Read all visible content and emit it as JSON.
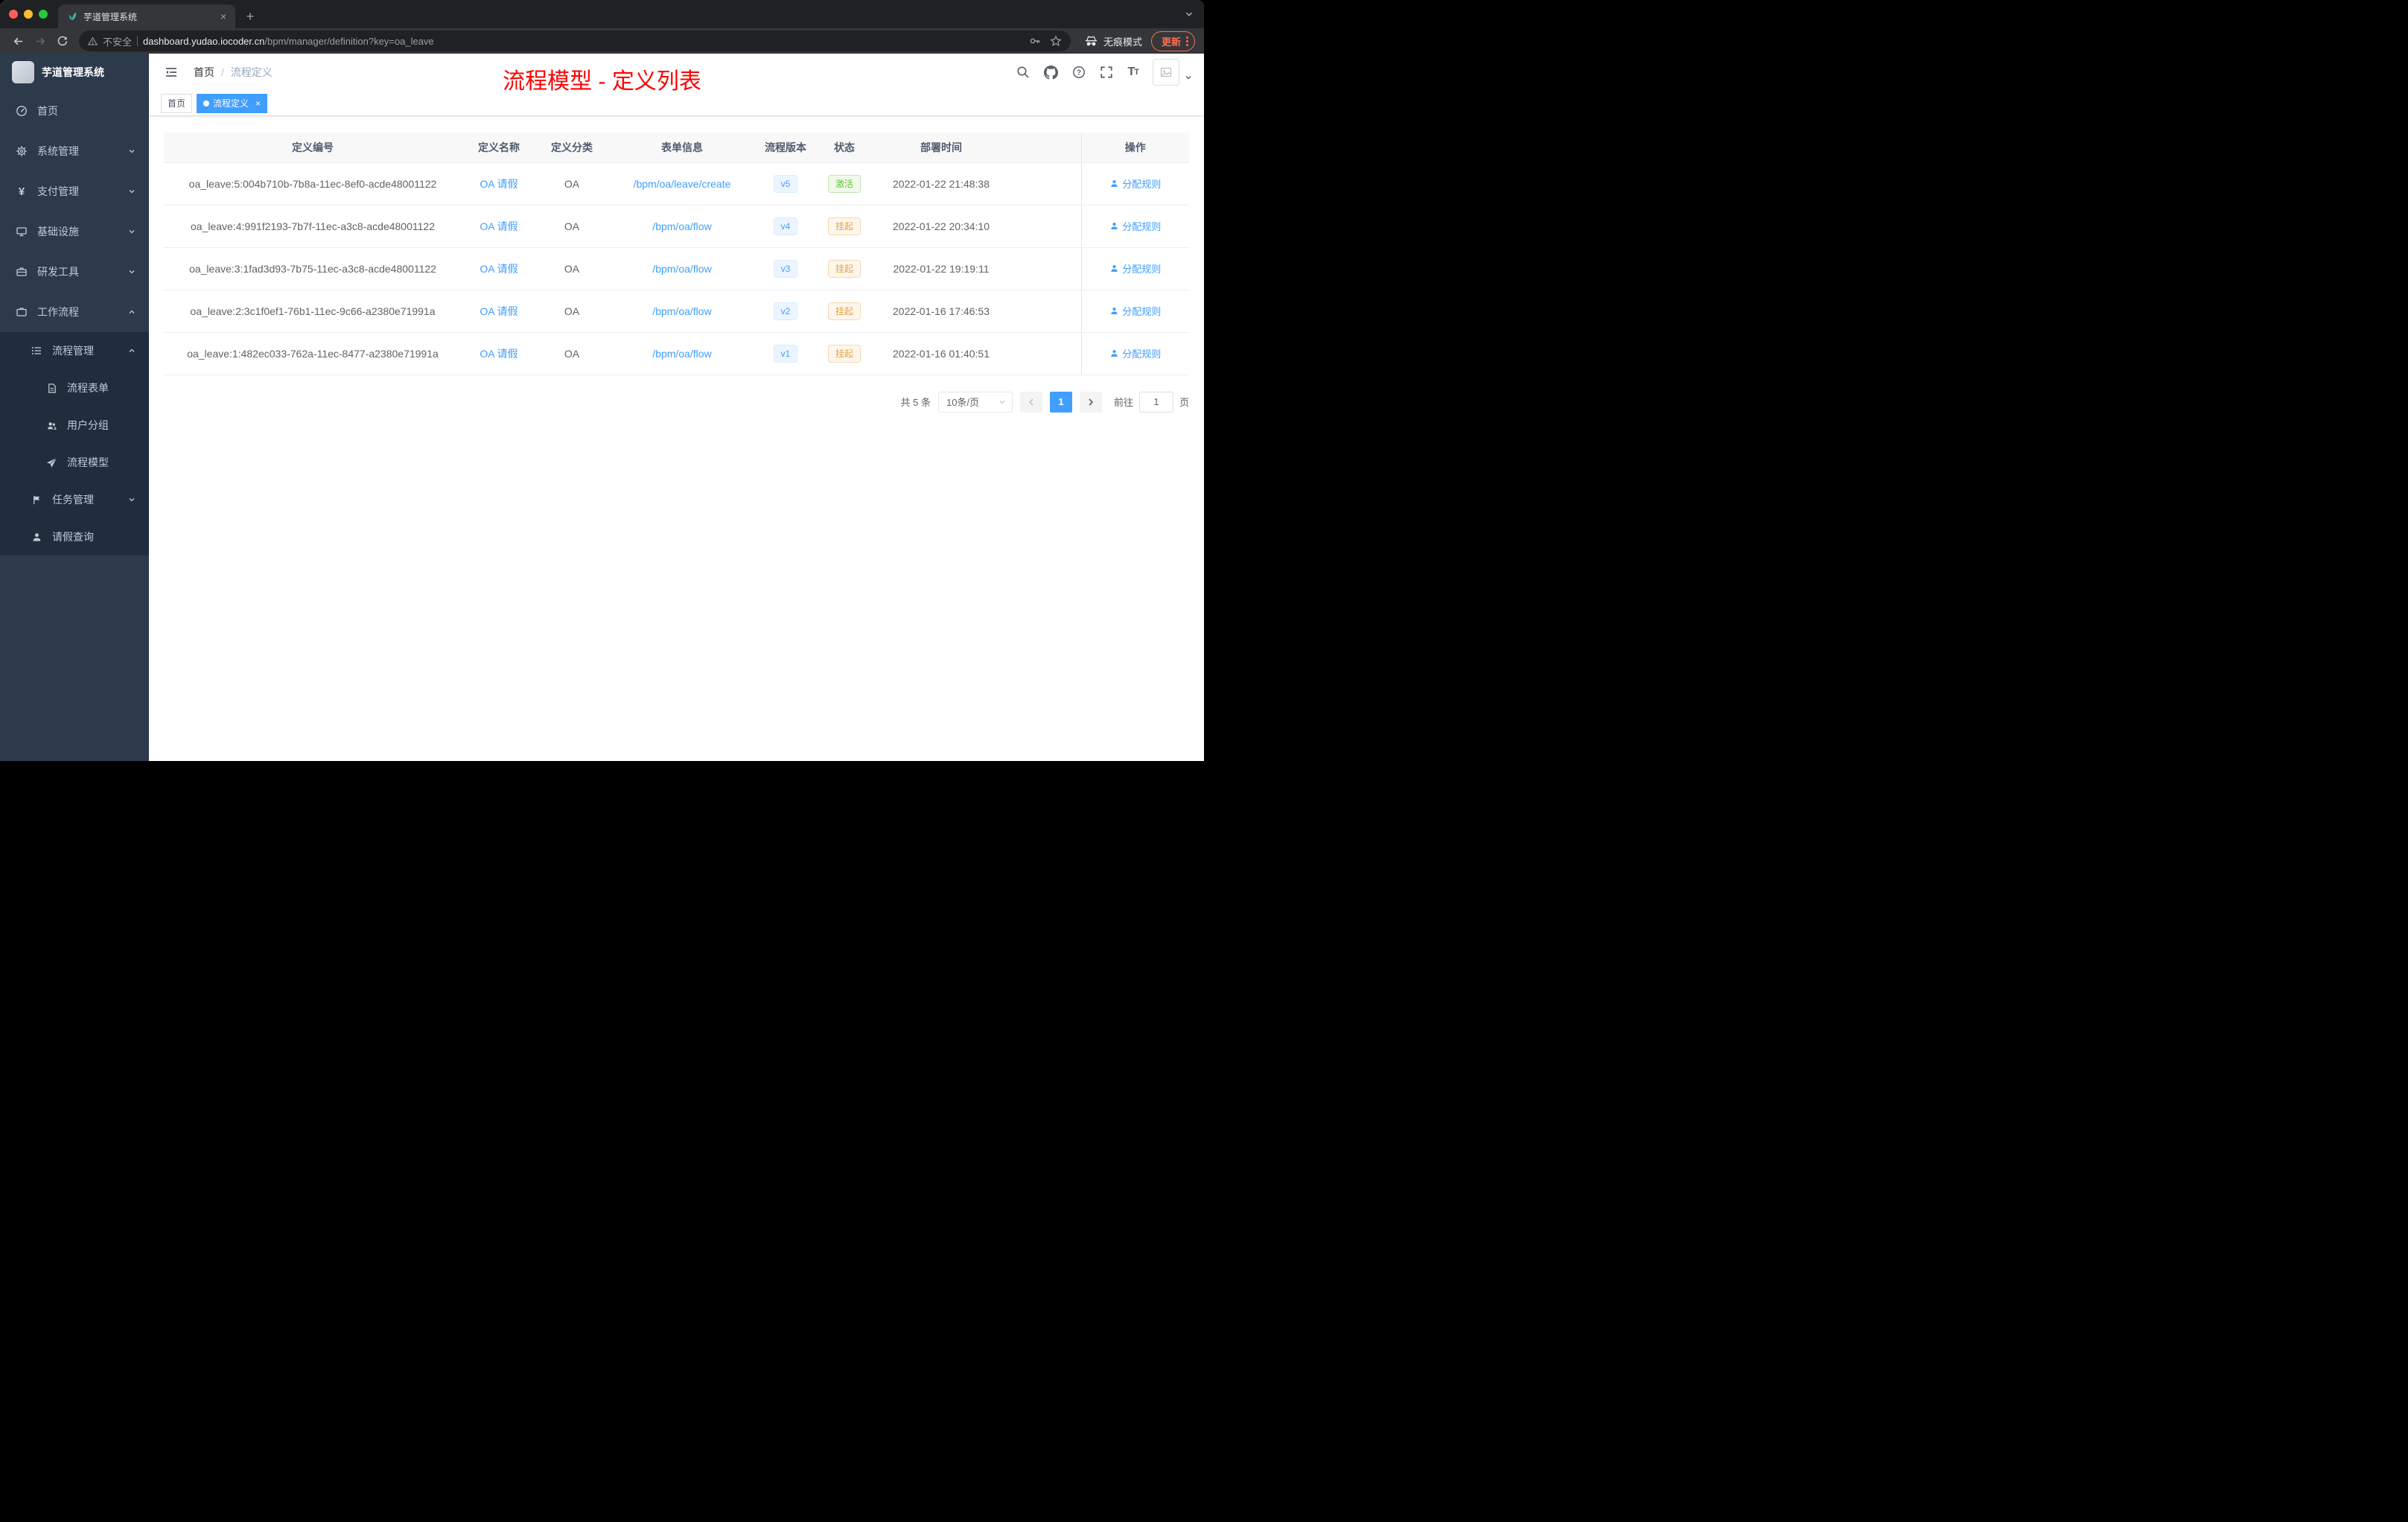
{
  "browser": {
    "tab": {
      "title": "芋道管理系统"
    },
    "toolbar": {
      "security_label": "不安全",
      "url_host": "dashboard.yudao.iocoder.cn",
      "url_path": "/bpm/manager/definition?key=oa_leave",
      "incognito_label": "无痕模式",
      "update_label": "更新"
    }
  },
  "sidebar": {
    "logo_title": "芋道管理系统",
    "menu": [
      {
        "label": "首页"
      },
      {
        "label": "系统管理"
      },
      {
        "label": "支付管理"
      },
      {
        "label": "基础设施"
      },
      {
        "label": "研发工具"
      },
      {
        "label": "工作流程"
      }
    ],
    "submenu": {
      "process_mgmt": {
        "label": "流程管理"
      },
      "children": [
        {
          "label": "流程表单"
        },
        {
          "label": "用户分组"
        },
        {
          "label": "流程模型"
        }
      ],
      "task_mgmt": {
        "label": "任务管理"
      },
      "leave_query": {
        "label": "请假查询"
      }
    }
  },
  "header": {
    "breadcrumb": {
      "home": "首页",
      "separator": "/",
      "current": "流程定义"
    },
    "annotation_title": "流程模型 - 定义列表"
  },
  "tags": {
    "home": "首页",
    "active": "流程定义"
  },
  "table": {
    "columns": [
      "定义编号",
      "定义名称",
      "定义分类",
      "表单信息",
      "流程版本",
      "状态",
      "部署时间",
      "操作"
    ],
    "action_label": "分配规则",
    "rows": [
      {
        "id": "oa_leave:5:004b710b-7b8a-11ec-8ef0-acde48001122",
        "name": "OA 请假",
        "category": "OA",
        "form": "/bpm/oa/leave/create",
        "version": "v5",
        "status": "激活",
        "status_type": "success",
        "time": "2022-01-22 21:48:38"
      },
      {
        "id": "oa_leave:4:991f2193-7b7f-11ec-a3c8-acde48001122",
        "name": "OA 请假",
        "category": "OA",
        "form": "/bpm/oa/flow",
        "version": "v4",
        "status": "挂起",
        "status_type": "warning",
        "time": "2022-01-22 20:34:10"
      },
      {
        "id": "oa_leave:3:1fad3d93-7b75-11ec-a3c8-acde48001122",
        "name": "OA 请假",
        "category": "OA",
        "form": "/bpm/oa/flow",
        "version": "v3",
        "status": "挂起",
        "status_type": "warning",
        "time": "2022-01-22 19:19:11"
      },
      {
        "id": "oa_leave:2:3c1f0ef1-76b1-11ec-9c66-a2380e71991a",
        "name": "OA 请假",
        "category": "OA",
        "form": "/bpm/oa/flow",
        "version": "v2",
        "status": "挂起",
        "status_type": "warning",
        "time": "2022-01-16 17:46:53"
      },
      {
        "id": "oa_leave:1:482ec033-762a-11ec-8477-a2380e71991a",
        "name": "OA 请假",
        "category": "OA",
        "form": "/bpm/oa/flow",
        "version": "v1",
        "status": "挂起",
        "status_type": "warning",
        "time": "2022-01-16 01:40:51"
      }
    ]
  },
  "pagination": {
    "total_label": "共 5 条",
    "page_size": "10条/页",
    "current_page": "1",
    "jump_prefix": "前往",
    "jump_value": "1",
    "jump_suffix": "页"
  },
  "colors": {
    "accent": "#409eff",
    "success": "#67c23a",
    "warning": "#e6a23c",
    "annotation": "#ff0000",
    "sidebar_bg": "#2d3a4b",
    "submenu_bg": "#1f2d3d"
  },
  "icons": {
    "search": "magnifier",
    "github": "octocat",
    "help": "question-circle",
    "fullscreen": "expand-corners",
    "font_size": "Tt",
    "incognito": "spectacles-hat",
    "assign_rule": "person",
    "favicon": "leaf"
  }
}
